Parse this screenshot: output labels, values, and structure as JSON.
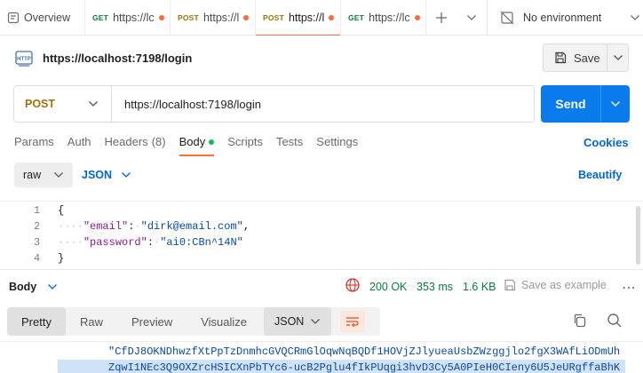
{
  "tabs": [
    {
      "method": "",
      "label": "Overview",
      "dot": false,
      "active": false
    },
    {
      "method": "GET",
      "label": "https://lc",
      "dot": true,
      "active": false
    },
    {
      "method": "POST",
      "label": "https://l",
      "dot": true,
      "active": false
    },
    {
      "method": "POST",
      "label": "https://l",
      "dot": true,
      "active": true
    },
    {
      "method": "GET",
      "label": "https://lc",
      "dot": true,
      "active": false
    }
  ],
  "environment": {
    "label": "No environment"
  },
  "request": {
    "title": "https://localhost:7198/login",
    "method": "POST",
    "url": "https://localhost:7198/login",
    "save_label": "Save",
    "send_label": "Send"
  },
  "request_tabs": {
    "params": "Params",
    "auth": "Auth",
    "headers": "Headers",
    "headers_count": "(8)",
    "body": "Body",
    "scripts": "Scripts",
    "tests": "Tests",
    "settings": "Settings",
    "cookies": "Cookies"
  },
  "body_options": {
    "mode": "raw",
    "language": "JSON",
    "beautify": "Beautify"
  },
  "editor": {
    "line_numbers": [
      "1",
      "2",
      "3",
      "4"
    ],
    "open_brace": "{",
    "close_brace": "}",
    "email_key": "\"email\"",
    "email_value": "\"dirk@email.com\"",
    "password_key": "\"password\"",
    "password_value": "\"ai0:CBn^14N\""
  },
  "response": {
    "body_label": "Body",
    "status": "200 OK",
    "time": "353 ms",
    "size": "1.6 KB",
    "save_example": "Save as example",
    "view_tabs": [
      "Pretty",
      "Raw",
      "Preview",
      "Visualize"
    ],
    "format": "JSON",
    "line1": "\"CfDJ8OKNDhwzfXtPpTzDnmhcGVQCRmGlOqwNqBQDf1HOVjZJlyueaUsbZWzggjlo2fgX3WAfLiODmUh",
    "line2": "ZqwI1NEc3Q9OXZrcHSICXnPbTYc6-ucB2Pglu4fIkPUqgi3hvD3Cy5A0PIeH0CIeny6U5JeURgffaBhK"
  },
  "colors": {
    "accent": "#ff6c37",
    "send": "#097bed",
    "link": "#0265d2",
    "post": "#a1720a",
    "get": "#0a7c3a",
    "success": "#0a7c3a"
  }
}
